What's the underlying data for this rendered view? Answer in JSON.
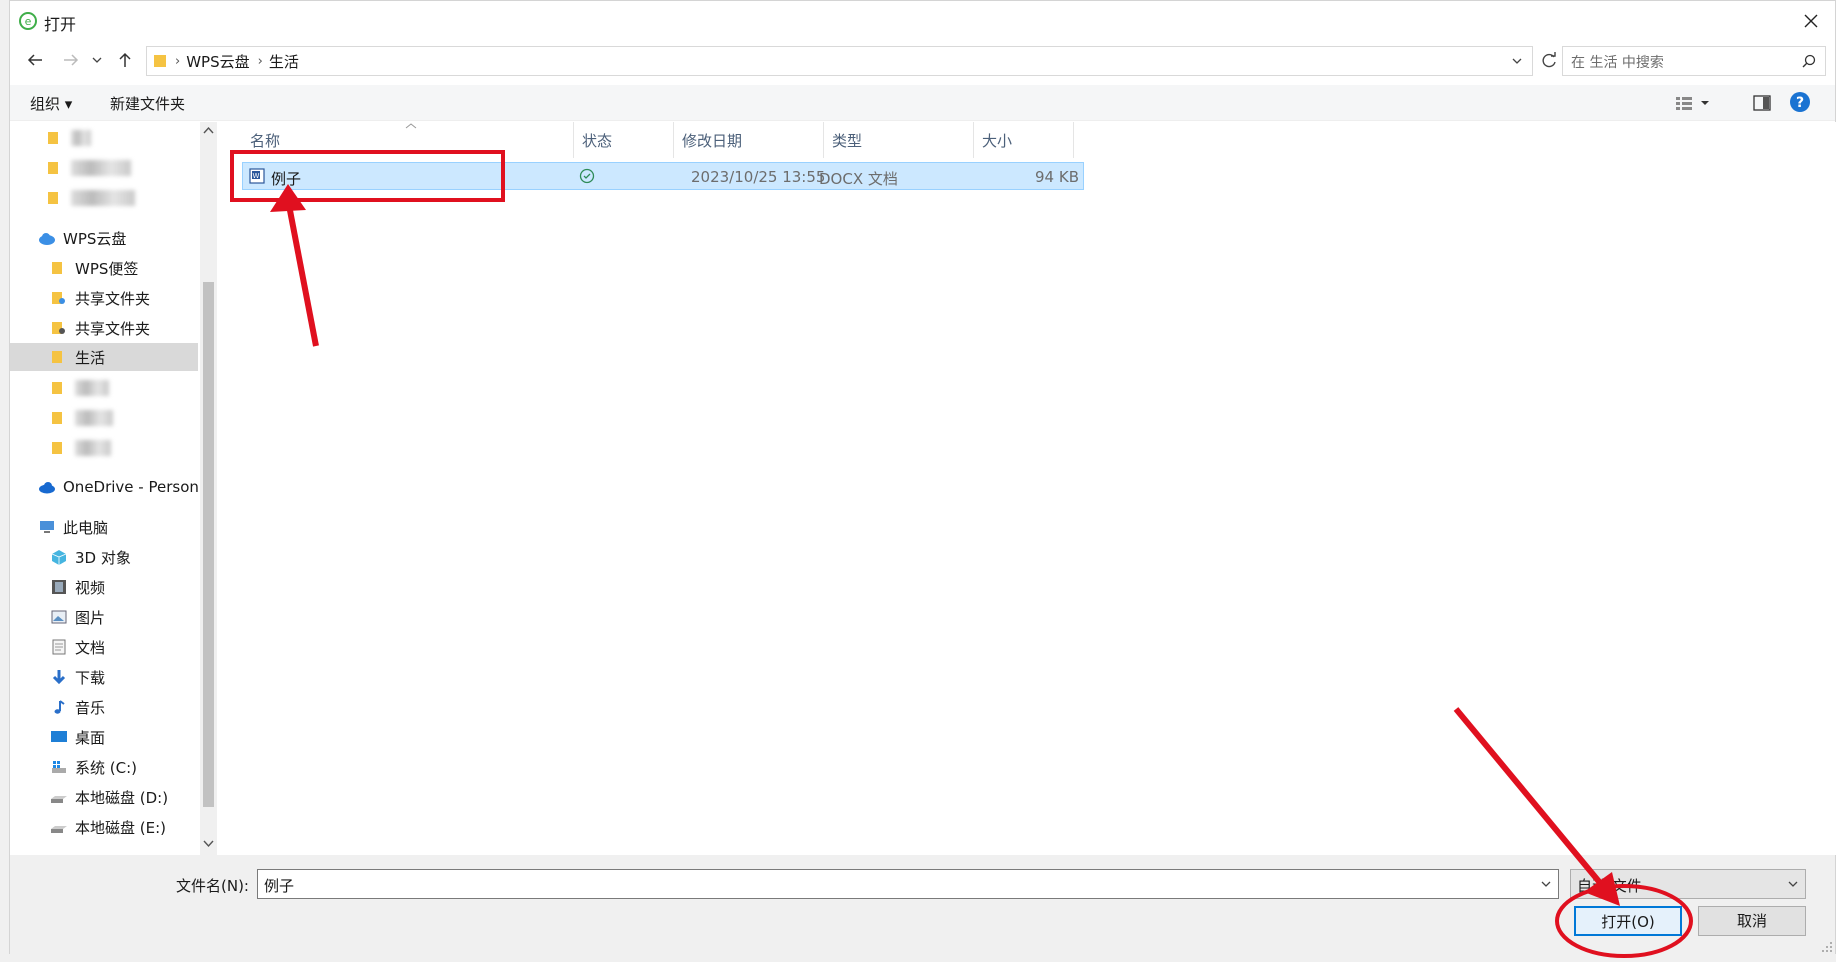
{
  "window": {
    "title": "打开"
  },
  "address": {
    "crumbs": [
      "WPS云盘",
      "生活"
    ]
  },
  "search": {
    "placeholder": "在 生活 中搜索"
  },
  "toolbar": {
    "organize_label": "组织 ▾",
    "new_folder_label": "新建文件夹"
  },
  "sidebar": {
    "items": [
      {
        "label": "WPS云盘"
      },
      {
        "label": "WPS便签"
      },
      {
        "label": "共享文件夹"
      },
      {
        "label": "共享文件夹"
      },
      {
        "label": "生活"
      },
      {
        "label": "OneDrive - Personal"
      },
      {
        "label": "此电脑"
      },
      {
        "label": "3D 对象"
      },
      {
        "label": "视频"
      },
      {
        "label": "图片"
      },
      {
        "label": "文档"
      },
      {
        "label": "下载"
      },
      {
        "label": "音乐"
      },
      {
        "label": "桌面"
      },
      {
        "label": "系统 (C:)"
      },
      {
        "label": "本地磁盘 (D:)"
      },
      {
        "label": "本地磁盘 (E:)"
      }
    ]
  },
  "columns": {
    "name": "名称",
    "status": "状态",
    "modified": "修改日期",
    "type": "类型",
    "size": "大小"
  },
  "files": [
    {
      "name": "例子",
      "modified": "2023/10/25 13:55",
      "type": "DOCX 文档",
      "size": "94 KB"
    }
  ],
  "footer": {
    "filename_label": "文件名(N):",
    "filename_value": "例子",
    "filetype_value": "自动 文件",
    "open_label": "打开(O)",
    "cancel_label": "取消"
  },
  "colors": {
    "accent": "#0078d7",
    "selection": "#cce8ff",
    "annotation": "#e0101f"
  }
}
